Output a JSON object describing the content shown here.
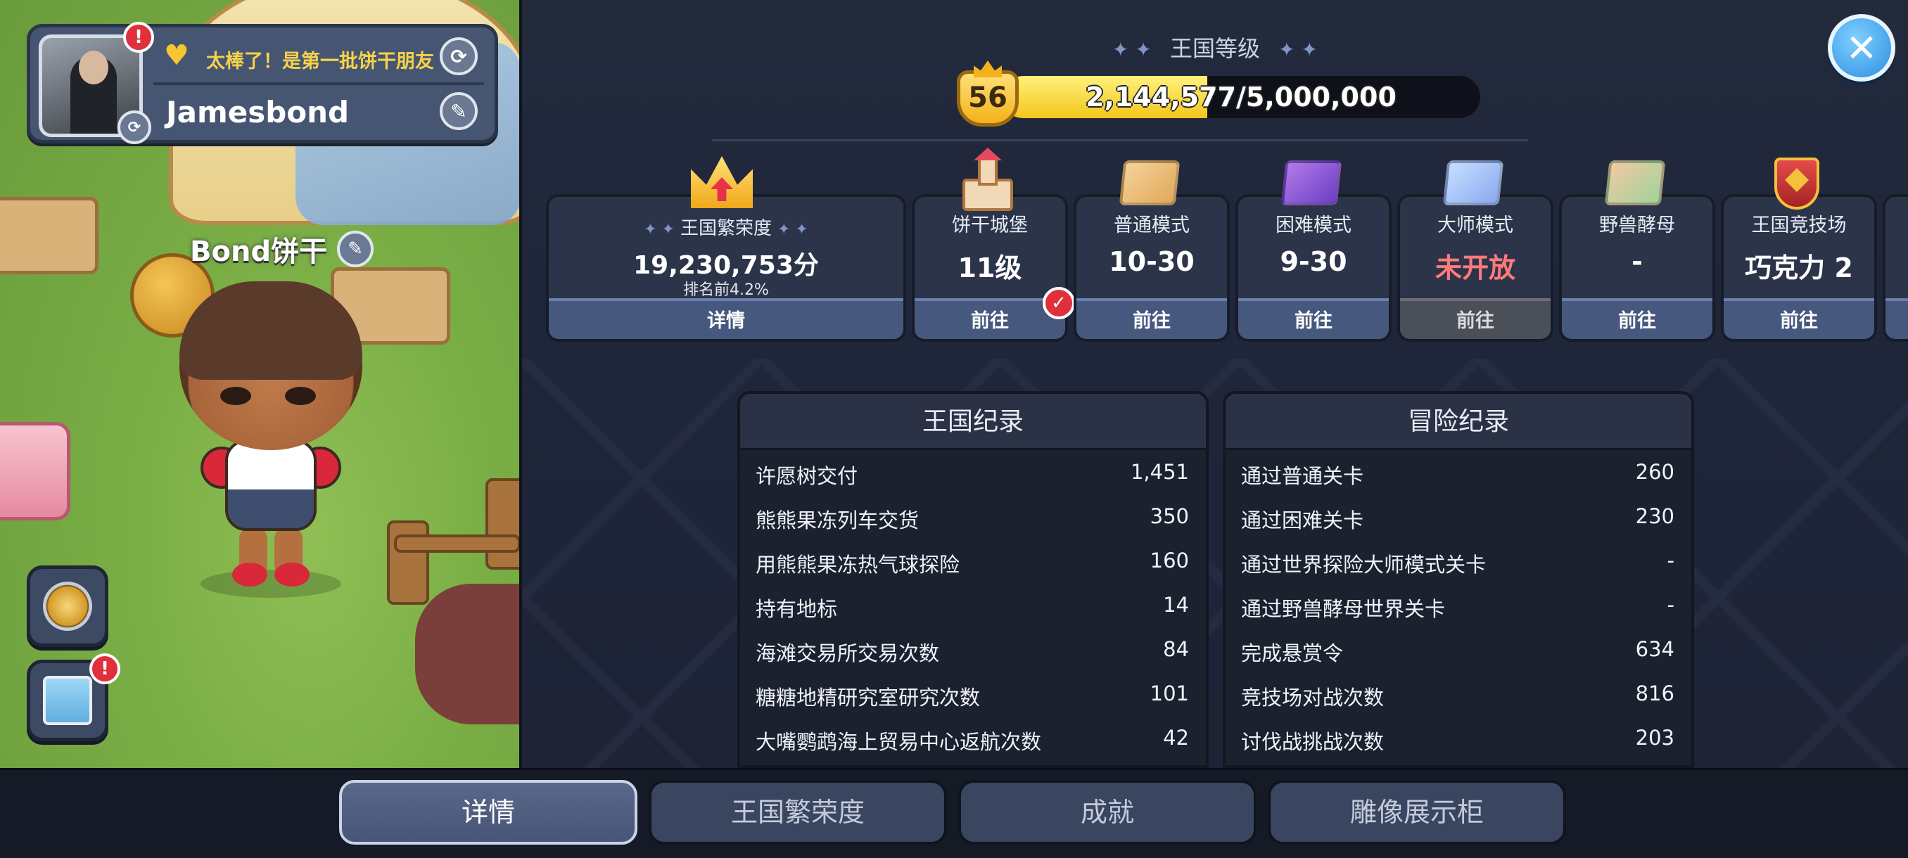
{
  "profile": {
    "message": "太棒了！是第一批饼干朋友",
    "player_name": "Jamesbond",
    "alert_mark": "!"
  },
  "cookie": {
    "name": "Bond饼干"
  },
  "kingdom_level": {
    "title": "王国等级",
    "level": "56",
    "exp_text": "2,144,577/5,000,000",
    "progress_fraction": 0.429
  },
  "prosperity": {
    "label": "王国繁荣度",
    "value": "19,230,753分",
    "rank": "排名前4.2%",
    "button": "详情"
  },
  "cards": [
    {
      "title": "饼干城堡",
      "value": "11级",
      "button": "前往",
      "icon": "castle-icon"
    },
    {
      "title": "普通模式",
      "value": "10-30",
      "button": "前往",
      "icon": "map-normal-icon"
    },
    {
      "title": "困难模式",
      "value": "9-30",
      "button": "前往",
      "icon": "map-hard-icon"
    },
    {
      "title": "大师模式",
      "value": "未开放",
      "button": "前往",
      "icon": "map-master-icon",
      "locked": true
    },
    {
      "title": "野兽酵母",
      "value": "-",
      "button": "前往",
      "icon": "map-beast-icon"
    },
    {
      "title": "王国竞技场",
      "value": "巧克力 2",
      "button": "前往",
      "icon": "arena-badge-icon"
    }
  ],
  "kingdom_record": {
    "title": "王国纪录",
    "rows": [
      {
        "label": "许愿树交付",
        "value": "1,451"
      },
      {
        "label": "熊熊果冻列车交货",
        "value": "350"
      },
      {
        "label": "用熊熊果冻热气球探险",
        "value": "160"
      },
      {
        "label": "持有地标",
        "value": "14"
      },
      {
        "label": "海滩交易所交易次数",
        "value": "84"
      },
      {
        "label": "糖糖地精研究室研究次数",
        "value": "101"
      },
      {
        "label": "大嘴鹦鹉海上贸易中心返航次数",
        "value": "42"
      }
    ]
  },
  "adventure_record": {
    "title": "冒险纪录",
    "rows": [
      {
        "label": "通过普通关卡",
        "value": "260"
      },
      {
        "label": "通过困难关卡",
        "value": "230"
      },
      {
        "label": "通过世界探险大师模式关卡",
        "value": "-"
      },
      {
        "label": "通过野兽酵母世界关卡",
        "value": "-"
      },
      {
        "label": "完成悬赏令",
        "value": "634"
      },
      {
        "label": "竞技场对战次数",
        "value": "816"
      },
      {
        "label": "讨伐战挑战次数",
        "value": "203"
      }
    ]
  },
  "tabs": [
    {
      "label": "详情",
      "active": true
    },
    {
      "label": "王国繁荣度",
      "active": false
    },
    {
      "label": "成就",
      "active": false
    },
    {
      "label": "雕像展示柜",
      "active": false
    }
  ],
  "colors": {
    "accent_gold": "#f3c61d",
    "alert_red": "#e0303c",
    "locked_text": "#ff7b7b",
    "close_blue": "#2d8ee0"
  }
}
